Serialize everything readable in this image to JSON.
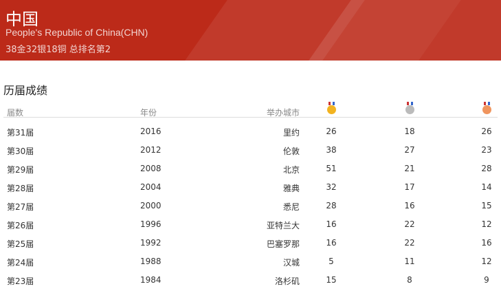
{
  "header": {
    "title": "中国",
    "subtitle": "People's Republic of China(CHN)",
    "summary": "38金32银18铜 总排名第2"
  },
  "section_title": "历届成绩",
  "table": {
    "columns": [
      "届数",
      "年份",
      "举办城市"
    ],
    "medal_icons": [
      {
        "name": "gold-medal-icon",
        "color": "#f2b320"
      },
      {
        "name": "silver-medal-icon",
        "color": "#bbbbbb"
      },
      {
        "name": "bronze-medal-icon",
        "color": "#f0955e"
      }
    ],
    "rows": [
      [
        "第31届",
        "2016",
        "里约",
        "26",
        "18",
        "26"
      ],
      [
        "第30届",
        "2012",
        "伦敦",
        "38",
        "27",
        "23"
      ],
      [
        "第29届",
        "2008",
        "北京",
        "51",
        "21",
        "28"
      ],
      [
        "第28届",
        "2004",
        "雅典",
        "32",
        "17",
        "14"
      ],
      [
        "第27届",
        "2000",
        "悉尼",
        "28",
        "16",
        "15"
      ],
      [
        "第26届",
        "1996",
        "亚特兰大",
        "16",
        "22",
        "12"
      ],
      [
        "第25届",
        "1992",
        "巴塞罗那",
        "16",
        "22",
        "16"
      ],
      [
        "第24届",
        "1988",
        "汉城",
        "5",
        "11",
        "12"
      ],
      [
        "第23届",
        "1984",
        "洛杉矶",
        "15",
        "8",
        "9"
      ]
    ]
  }
}
